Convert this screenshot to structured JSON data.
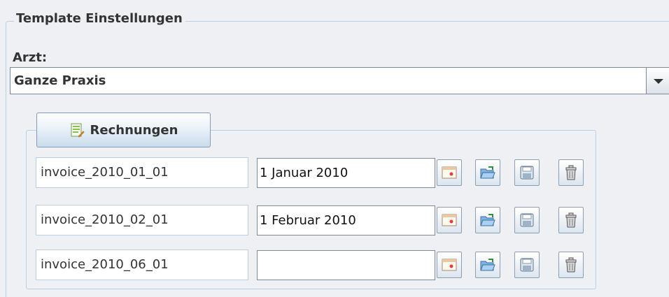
{
  "template_settings": {
    "title": "Template Einstellungen",
    "doctor_label": "Arzt:",
    "doctor_selected": "Ganze Praxis"
  },
  "invoices": {
    "section_button_label": "Rechnungen",
    "rows": [
      {
        "name": "invoice_2010_01_01",
        "date": "1 Januar 2010"
      },
      {
        "name": "invoice_2010_02_01",
        "date": "1 Februar 2010"
      },
      {
        "name": "invoice_2010_06_01",
        "date": ""
      }
    ]
  },
  "icons": {
    "combo": "chevron-down-icon",
    "section": "document-edit-icon",
    "calendar": "calendar-icon",
    "open": "folder-open-icon",
    "save": "floppy-disk-icon",
    "delete": "trash-icon"
  },
  "colors": {
    "background": "#eef0f3",
    "frame_border": "#b8cfe5",
    "text": "#333333"
  }
}
